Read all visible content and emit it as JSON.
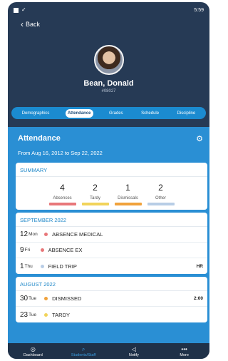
{
  "status_bar": {
    "time": "5:59"
  },
  "nav": {
    "back_label": "Back"
  },
  "student": {
    "name": "Bean, Donald",
    "id": "#08027"
  },
  "tabs": [
    {
      "label": "Demographics"
    },
    {
      "label": "Attendance",
      "active": true
    },
    {
      "label": "Grades"
    },
    {
      "label": "Schedule"
    },
    {
      "label": "Discipline"
    }
  ],
  "attendance": {
    "title": "Attendance",
    "date_range": "From Aug 16, 2012 to Sep 22, 2022"
  },
  "summary": {
    "title": "SUMMARY",
    "items": [
      {
        "value": "4",
        "label": "Absences",
        "color": "#e8777a"
      },
      {
        "value": "2",
        "label": "Tardy",
        "color": "#f1d35a"
      },
      {
        "value": "1",
        "label": "Dismissals",
        "color": "#f0a23c"
      },
      {
        "value": "2",
        "label": "Other",
        "color": "#b8cde6"
      }
    ]
  },
  "months": [
    {
      "title": "SEPTEMBER 2022",
      "rows": [
        {
          "day": "12",
          "weekday": "Mon",
          "desc": "ABSENCE MEDICAL",
          "dot": "#e8777a",
          "right": ""
        },
        {
          "day": "9",
          "weekday": "Fri",
          "desc": "ABSENCE EX",
          "dot": "#e8777a",
          "right": ""
        },
        {
          "day": "1",
          "weekday": "Thu",
          "desc": "FIELD TRIP",
          "dot": "#b8cde6",
          "right": "HR"
        }
      ]
    },
    {
      "title": "AUGUST 2022",
      "rows": [
        {
          "day": "30",
          "weekday": "Tue",
          "desc": "DISMISSED",
          "dot": "#f0a23c",
          "right": "2:00"
        },
        {
          "day": "23",
          "weekday": "Tue",
          "desc": "TARDY",
          "dot": "#f1d35a",
          "right": ""
        }
      ]
    }
  ],
  "bottom_nav": [
    {
      "label": "Dashboard",
      "icon": "dashboard-icon"
    },
    {
      "label": "Students/Staff",
      "icon": "search-icon",
      "active": true
    },
    {
      "label": "Notify",
      "icon": "megaphone-icon"
    },
    {
      "label": "More",
      "icon": "more-icon"
    }
  ],
  "colors": {
    "header_bg": "#263a55",
    "accent": "#2a8fd4",
    "tab_bar": "#1b8bd0"
  }
}
